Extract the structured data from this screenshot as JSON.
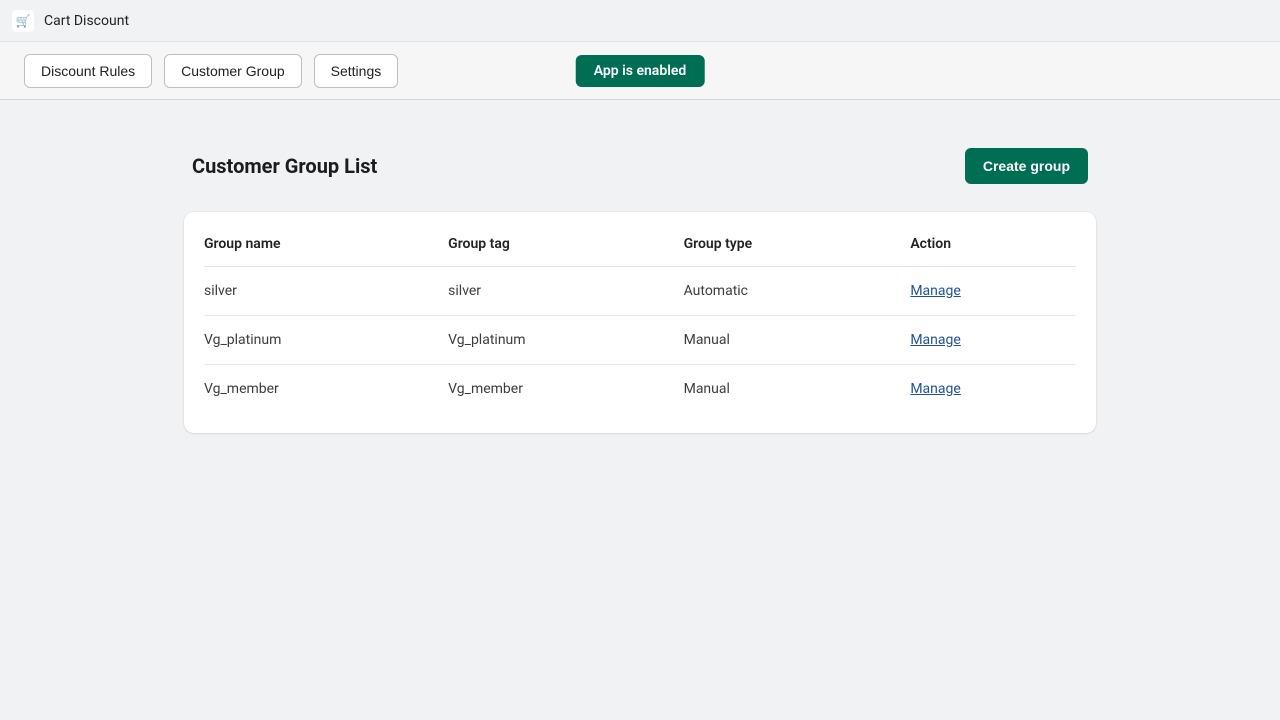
{
  "header": {
    "app_title": "Cart Discount",
    "app_icon": "🛒"
  },
  "nav": {
    "buttons": [
      {
        "label": "Discount Rules"
      },
      {
        "label": "Customer Group"
      },
      {
        "label": "Settings"
      }
    ],
    "status": "App is enabled"
  },
  "page": {
    "title": "Customer Group List",
    "create_label": "Create group"
  },
  "table": {
    "headers": {
      "name": "Group name",
      "tag": "Group tag",
      "type": "Group type",
      "action": "Action"
    },
    "rows": [
      {
        "name": "silver",
        "tag": "silver",
        "type": "Automatic",
        "action": "Manage"
      },
      {
        "name": "Vg_platinum",
        "tag": "Vg_platinum",
        "type": "Manual",
        "action": "Manage"
      },
      {
        "name": "Vg_member",
        "tag": "Vg_member",
        "type": "Manual",
        "action": "Manage"
      }
    ]
  }
}
